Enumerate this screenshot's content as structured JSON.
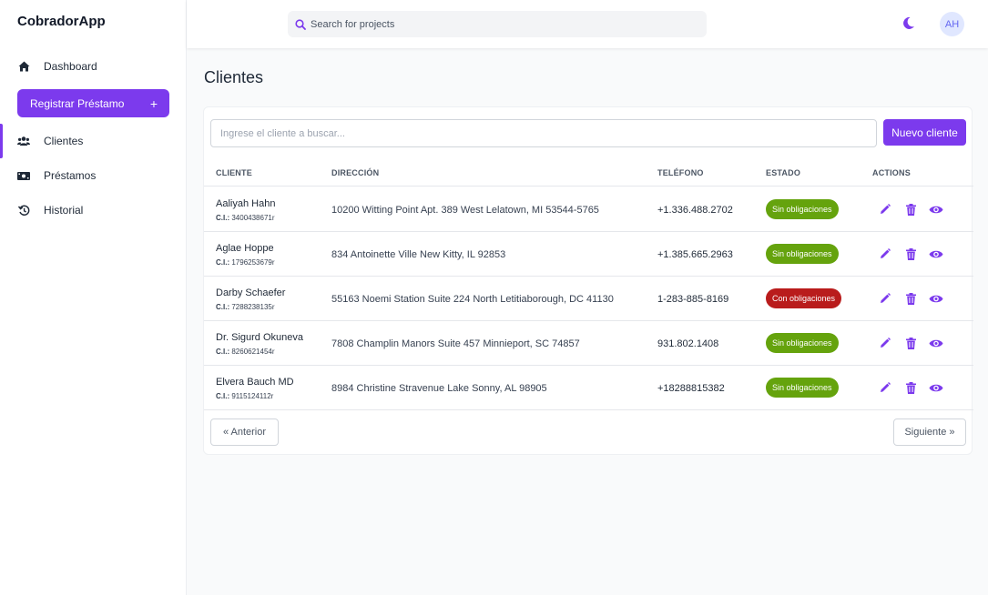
{
  "app": {
    "name": "CobradorApp"
  },
  "sidebar": {
    "items": [
      {
        "label": "Dashboard",
        "icon": "home-icon"
      },
      {
        "label": "Clientes",
        "icon": "users-icon"
      },
      {
        "label": "Préstamos",
        "icon": "money-icon"
      },
      {
        "label": "Historial",
        "icon": "history-icon"
      }
    ],
    "register_button": {
      "label": "Registrar Préstamo",
      "plus": "+"
    }
  },
  "header": {
    "search_placeholder": "Search for projects",
    "avatar_initials": "AH"
  },
  "main": {
    "title": "Clientes",
    "search_placeholder": "Ingrese el cliente a buscar...",
    "new_button": "Nuevo cliente",
    "columns": [
      "CLIENTE",
      "DIRECCIÓN",
      "TELÉFONO",
      "ESTADO",
      "ACTIONS"
    ],
    "ci_label": "C.I.:",
    "rows": [
      {
        "name": "Aaliyah Hahn",
        "ci": "3400438671r",
        "address": "10200 Witting Point Apt. 389 West Lelatown, MI 53544-5765",
        "phone": "+1.336.488.2702",
        "status": "Sin obligaciones",
        "status_type": "ok"
      },
      {
        "name": "Aglae Hoppe",
        "ci": "1796253679r",
        "address": "834 Antoinette Ville New Kitty, IL 92853",
        "phone": "+1.385.665.2963",
        "status": "Sin obligaciones",
        "status_type": "ok"
      },
      {
        "name": "Darby Schaefer",
        "ci": "7288238135r",
        "address": "55163 Noemi Station Suite 224 North Letitiaborough, DC 41130",
        "phone": "1-283-885-8169",
        "status": "Con obligaciones",
        "status_type": "no"
      },
      {
        "name": "Dr. Sigurd Okuneva",
        "ci": "8260621454r",
        "address": "7808 Champlin Manors Suite 457 Minnieport, SC 74857",
        "phone": "931.802.1408",
        "status": "Sin obligaciones",
        "status_type": "ok"
      },
      {
        "name": "Elvera Bauch MD",
        "ci": "9115124112r",
        "address": "8984 Christine Stravenue Lake Sonny, AL 98905",
        "phone": "+18288815382",
        "status": "Sin obligaciones",
        "status_type": "ok"
      }
    ],
    "pagination": {
      "prev": "« Anterior",
      "next": "Siguiente »"
    }
  },
  "colors": {
    "accent": "#7c3aed",
    "ok": "#65a30d",
    "danger": "#b91c1c"
  }
}
